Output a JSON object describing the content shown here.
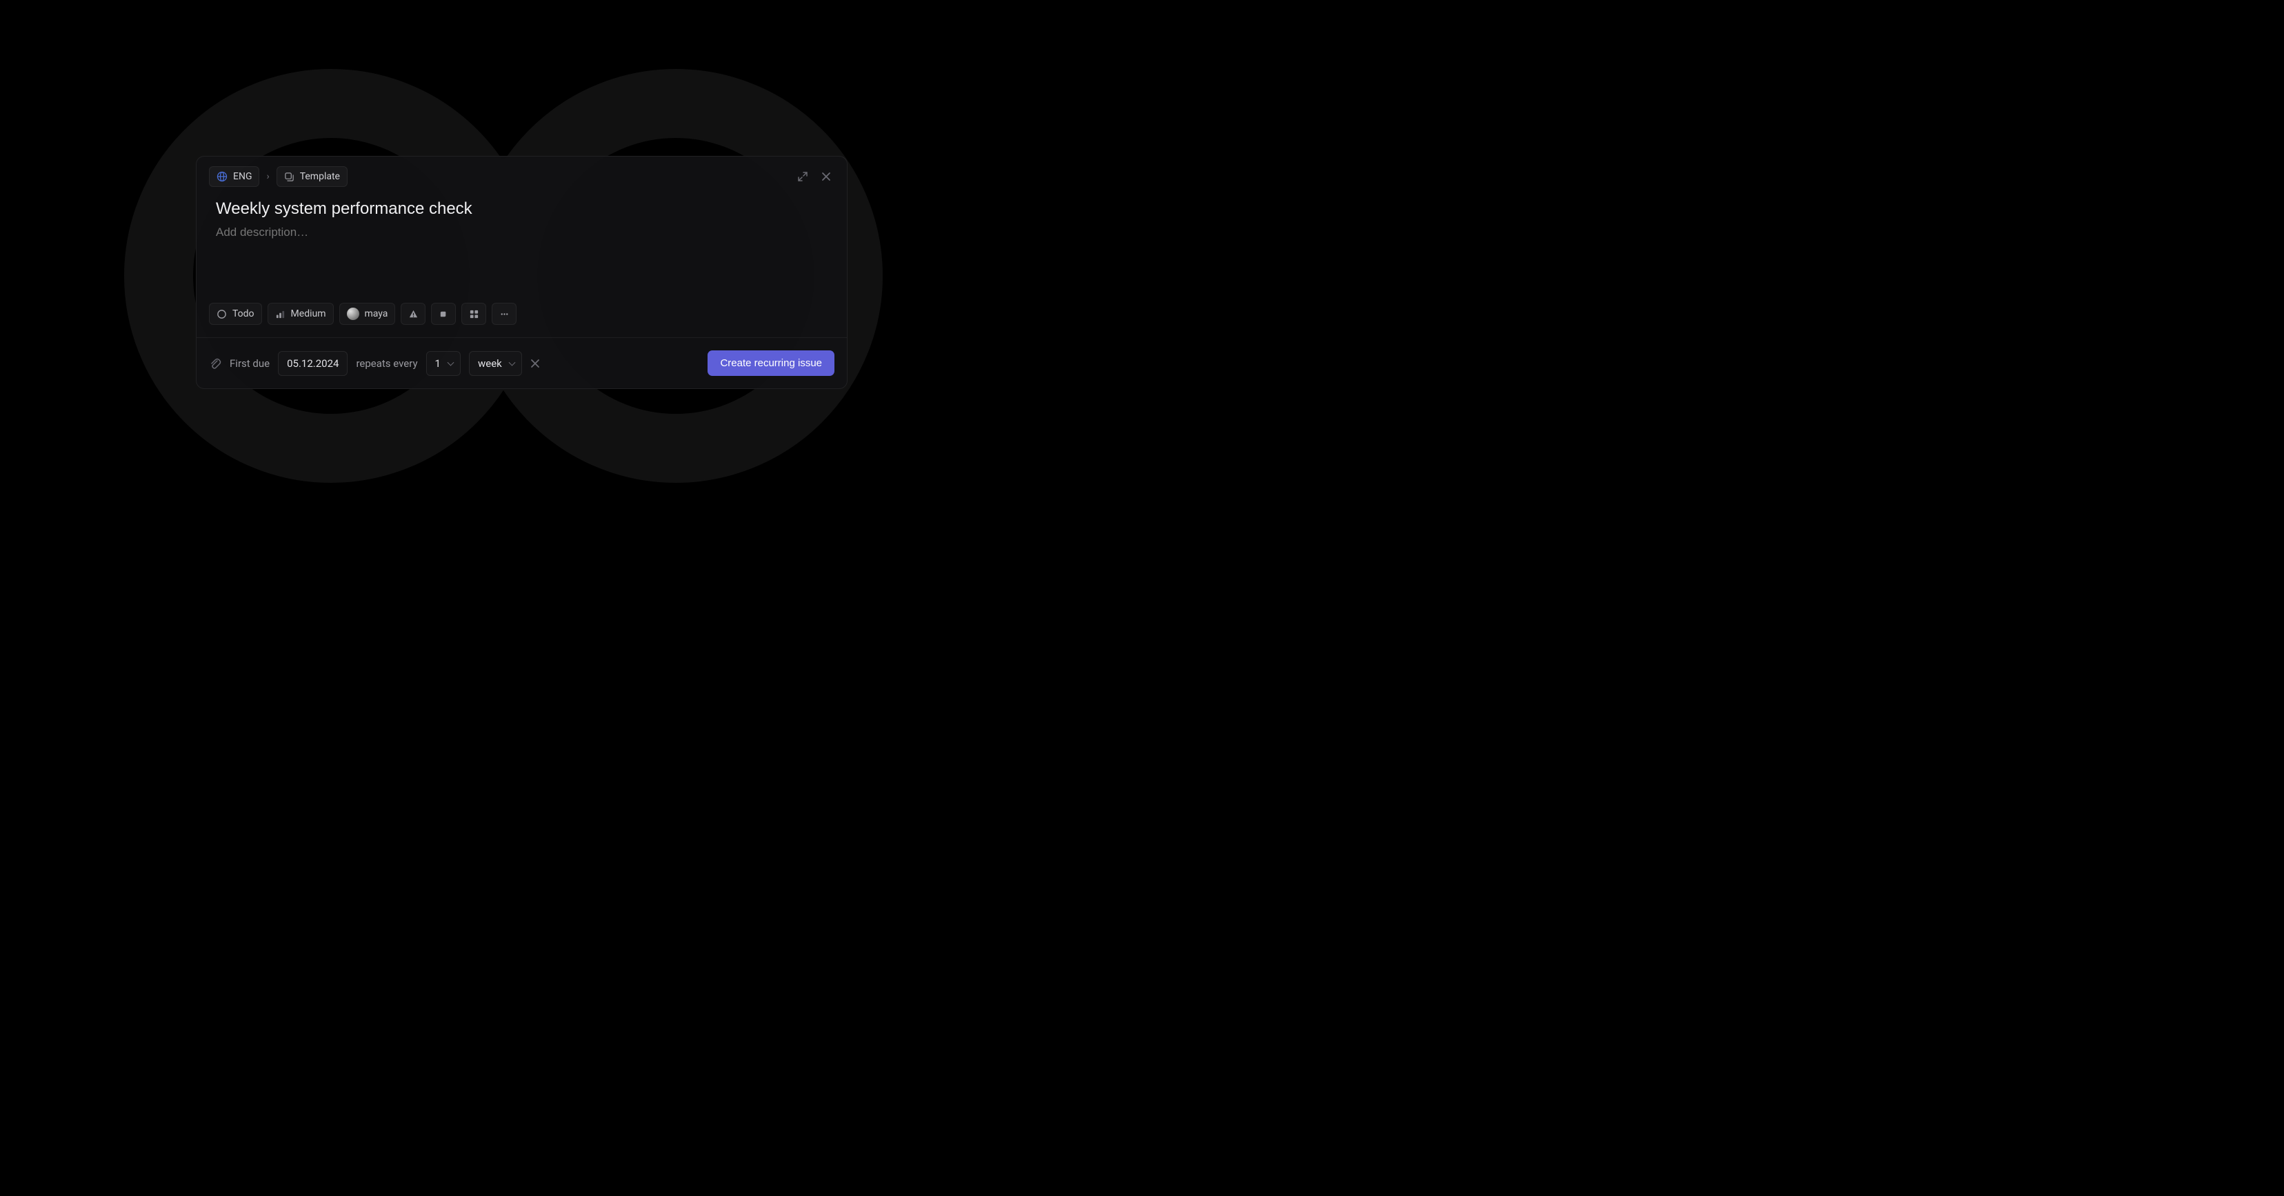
{
  "breadcrumb": {
    "project_label": "ENG",
    "separator": "›",
    "template_label": "Template"
  },
  "issue": {
    "title": "Weekly system performance check",
    "description_placeholder": "Add description…"
  },
  "props": {
    "status_label": "Todo",
    "priority_label": "Medium",
    "assignee_label": "maya"
  },
  "recurrence": {
    "first_due_label": "First due",
    "first_due_value": "05.12.2024",
    "repeats_label": "repeats every",
    "count_value": "1",
    "unit_value": "week"
  },
  "actions": {
    "submit_label": "Create recurring issue"
  }
}
